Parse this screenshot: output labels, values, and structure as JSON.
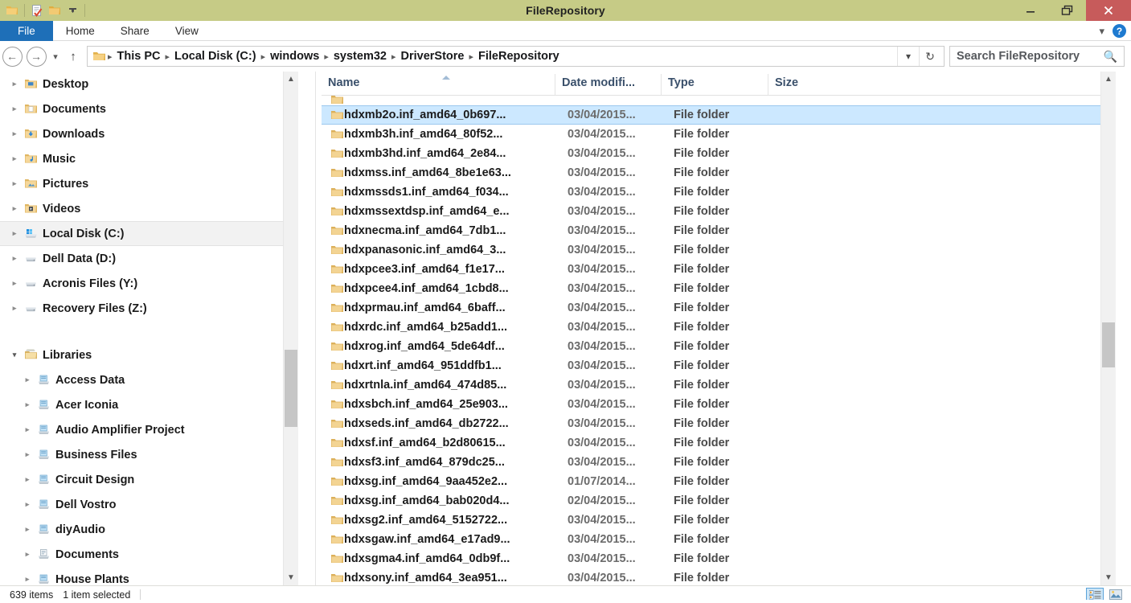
{
  "window": {
    "title": "FileRepository",
    "quick_access": [
      {
        "name": "folder-icon",
        "label": "Folder"
      },
      {
        "name": "properties-icon",
        "label": "Properties"
      },
      {
        "name": "new-folder-icon",
        "label": "New folder"
      },
      {
        "name": "customize-dropdown-icon",
        "label": "Customize Quick Access Toolbar"
      }
    ],
    "controls": {
      "minimize": "Minimize",
      "restore": "Restore",
      "close": "Close"
    },
    "titlebar_color": "#c6cb86",
    "close_color": "#c75b5b"
  },
  "ribbon": {
    "tabs": [
      {
        "label": "File",
        "active": true
      },
      {
        "label": "Home",
        "active": false
      },
      {
        "label": "Share",
        "active": false
      },
      {
        "label": "View",
        "active": false
      }
    ],
    "expand_label": "Expand the Ribbon",
    "help_label": "?",
    "file_tab_color": "#1e6fb8"
  },
  "addressbar": {
    "back_label": "Back",
    "forward_label": "Forward",
    "recent_label": "Recent locations",
    "up_label": "Up one level",
    "breadcrumbs": [
      "This PC",
      "Local Disk (C:)",
      "windows",
      "system32",
      "DriverStore",
      "FileRepository"
    ],
    "history_label": "Previous locations",
    "refresh_label": "Refresh"
  },
  "search": {
    "placeholder": "Search FileRepository",
    "icon": "search-icon"
  },
  "sidebar": {
    "items": [
      {
        "label": "Desktop",
        "icon": "desktop-folder-icon",
        "indent": 1,
        "expander": "collapsed",
        "selected": false
      },
      {
        "label": "Documents",
        "icon": "documents-folder-icon",
        "indent": 1,
        "expander": "collapsed",
        "selected": false
      },
      {
        "label": "Downloads",
        "icon": "downloads-folder-icon",
        "indent": 1,
        "expander": "collapsed",
        "selected": false
      },
      {
        "label": "Music",
        "icon": "music-folder-icon",
        "indent": 1,
        "expander": "collapsed",
        "selected": false
      },
      {
        "label": "Pictures",
        "icon": "pictures-folder-icon",
        "indent": 1,
        "expander": "collapsed",
        "selected": false
      },
      {
        "label": "Videos",
        "icon": "videos-folder-icon",
        "indent": 1,
        "expander": "collapsed",
        "selected": false
      },
      {
        "label": "Local Disk (C:)",
        "icon": "local-disk-icon",
        "indent": 1,
        "expander": "collapsed",
        "selected": true
      },
      {
        "label": "Dell Data (D:)",
        "icon": "drive-icon",
        "indent": 1,
        "expander": "collapsed",
        "selected": false
      },
      {
        "label": "Acronis Files (Y:)",
        "icon": "drive-icon",
        "indent": 1,
        "expander": "collapsed",
        "selected": false
      },
      {
        "label": "Recovery Files (Z:)",
        "icon": "drive-icon",
        "indent": 1,
        "expander": "collapsed",
        "selected": false
      },
      {
        "label": "",
        "icon": "spacer",
        "indent": 0,
        "expander": "none",
        "selected": false
      },
      {
        "label": "Libraries",
        "icon": "libraries-icon",
        "indent": 0,
        "expander": "expanded",
        "selected": false
      },
      {
        "label": "Access Data",
        "icon": "library-icon",
        "indent": 2,
        "expander": "collapsed",
        "selected": false
      },
      {
        "label": "Acer Iconia",
        "icon": "library-icon",
        "indent": 2,
        "expander": "collapsed",
        "selected": false
      },
      {
        "label": "Audio Amplifier Project",
        "icon": "library-icon",
        "indent": 2,
        "expander": "collapsed",
        "selected": false
      },
      {
        "label": "Business Files",
        "icon": "library-icon",
        "indent": 2,
        "expander": "collapsed",
        "selected": false
      },
      {
        "label": "Circuit Design",
        "icon": "library-icon",
        "indent": 2,
        "expander": "collapsed",
        "selected": false
      },
      {
        "label": "Dell Vostro",
        "icon": "library-icon",
        "indent": 2,
        "expander": "collapsed",
        "selected": false
      },
      {
        "label": "diyAudio",
        "icon": "library-icon",
        "indent": 2,
        "expander": "collapsed",
        "selected": false
      },
      {
        "label": "Documents",
        "icon": "documents-library-icon",
        "indent": 2,
        "expander": "collapsed",
        "selected": false
      },
      {
        "label": "House Plants",
        "icon": "library-icon",
        "indent": 2,
        "expander": "collapsed",
        "selected": false
      }
    ]
  },
  "filelist": {
    "columns": [
      {
        "label": "Name",
        "sort": "ascending"
      },
      {
        "label": "Date modifi...",
        "sort": "none"
      },
      {
        "label": "Type",
        "sort": "none"
      },
      {
        "label": "Size",
        "sort": "none"
      }
    ],
    "rows": [
      {
        "name": "hdxmb2o.inf_amd64_0b697...",
        "date": "03/04/2015...",
        "type": "File folder",
        "size": "",
        "selected": true
      },
      {
        "name": "hdxmb3h.inf_amd64_80f52...",
        "date": "03/04/2015...",
        "type": "File folder",
        "size": "",
        "selected": false
      },
      {
        "name": "hdxmb3hd.inf_amd64_2e84...",
        "date": "03/04/2015...",
        "type": "File folder",
        "size": "",
        "selected": false
      },
      {
        "name": "hdxmss.inf_amd64_8be1e63...",
        "date": "03/04/2015...",
        "type": "File folder",
        "size": "",
        "selected": false
      },
      {
        "name": "hdxmssds1.inf_amd64_f034...",
        "date": "03/04/2015...",
        "type": "File folder",
        "size": "",
        "selected": false
      },
      {
        "name": "hdxmssextdsp.inf_amd64_e...",
        "date": "03/04/2015...",
        "type": "File folder",
        "size": "",
        "selected": false
      },
      {
        "name": "hdxnecma.inf_amd64_7db1...",
        "date": "03/04/2015...",
        "type": "File folder",
        "size": "",
        "selected": false
      },
      {
        "name": "hdxpanasonic.inf_amd64_3...",
        "date": "03/04/2015...",
        "type": "File folder",
        "size": "",
        "selected": false
      },
      {
        "name": "hdxpcee3.inf_amd64_f1e17...",
        "date": "03/04/2015...",
        "type": "File folder",
        "size": "",
        "selected": false
      },
      {
        "name": "hdxpcee4.inf_amd64_1cbd8...",
        "date": "03/04/2015...",
        "type": "File folder",
        "size": "",
        "selected": false
      },
      {
        "name": "hdxprmau.inf_amd64_6baff...",
        "date": "03/04/2015...",
        "type": "File folder",
        "size": "",
        "selected": false
      },
      {
        "name": "hdxrdc.inf_amd64_b25add1...",
        "date": "03/04/2015...",
        "type": "File folder",
        "size": "",
        "selected": false
      },
      {
        "name": "hdxrog.inf_amd64_5de64df...",
        "date": "03/04/2015...",
        "type": "File folder",
        "size": "",
        "selected": false
      },
      {
        "name": "hdxrt.inf_amd64_951ddfb1...",
        "date": "03/04/2015...",
        "type": "File folder",
        "size": "",
        "selected": false
      },
      {
        "name": "hdxrtnla.inf_amd64_474d85...",
        "date": "03/04/2015...",
        "type": "File folder",
        "size": "",
        "selected": false
      },
      {
        "name": "hdxsbch.inf_amd64_25e903...",
        "date": "03/04/2015...",
        "type": "File folder",
        "size": "",
        "selected": false
      },
      {
        "name": "hdxseds.inf_amd64_db2722...",
        "date": "03/04/2015...",
        "type": "File folder",
        "size": "",
        "selected": false
      },
      {
        "name": "hdxsf.inf_amd64_b2d80615...",
        "date": "03/04/2015...",
        "type": "File folder",
        "size": "",
        "selected": false
      },
      {
        "name": "hdxsf3.inf_amd64_879dc25...",
        "date": "03/04/2015...",
        "type": "File folder",
        "size": "",
        "selected": false
      },
      {
        "name": "hdxsg.inf_amd64_9aa452e2...",
        "date": "01/07/2014...",
        "type": "File folder",
        "size": "",
        "selected": false
      },
      {
        "name": "hdxsg.inf_amd64_bab020d4...",
        "date": "02/04/2015...",
        "type": "File folder",
        "size": "",
        "selected": false
      },
      {
        "name": "hdxsg2.inf_amd64_5152722...",
        "date": "03/04/2015...",
        "type": "File folder",
        "size": "",
        "selected": false
      },
      {
        "name": "hdxsgaw.inf_amd64_e17ad9...",
        "date": "03/04/2015...",
        "type": "File folder",
        "size": "",
        "selected": false
      },
      {
        "name": "hdxsgma4.inf_amd64_0db9f...",
        "date": "03/04/2015...",
        "type": "File folder",
        "size": "",
        "selected": false
      },
      {
        "name": "hdxsony.inf_amd64_3ea951...",
        "date": "03/04/2015...",
        "type": "File folder",
        "size": "",
        "selected": false
      }
    ],
    "selection_color": "#cce8ff"
  },
  "statusbar": {
    "item_count": "639 items",
    "selection_info": "1 item selected",
    "views": [
      {
        "name": "details-view-button",
        "label": "Details view",
        "active": true
      },
      {
        "name": "large-icons-view-button",
        "label": "Large icons view",
        "active": false
      }
    ]
  }
}
